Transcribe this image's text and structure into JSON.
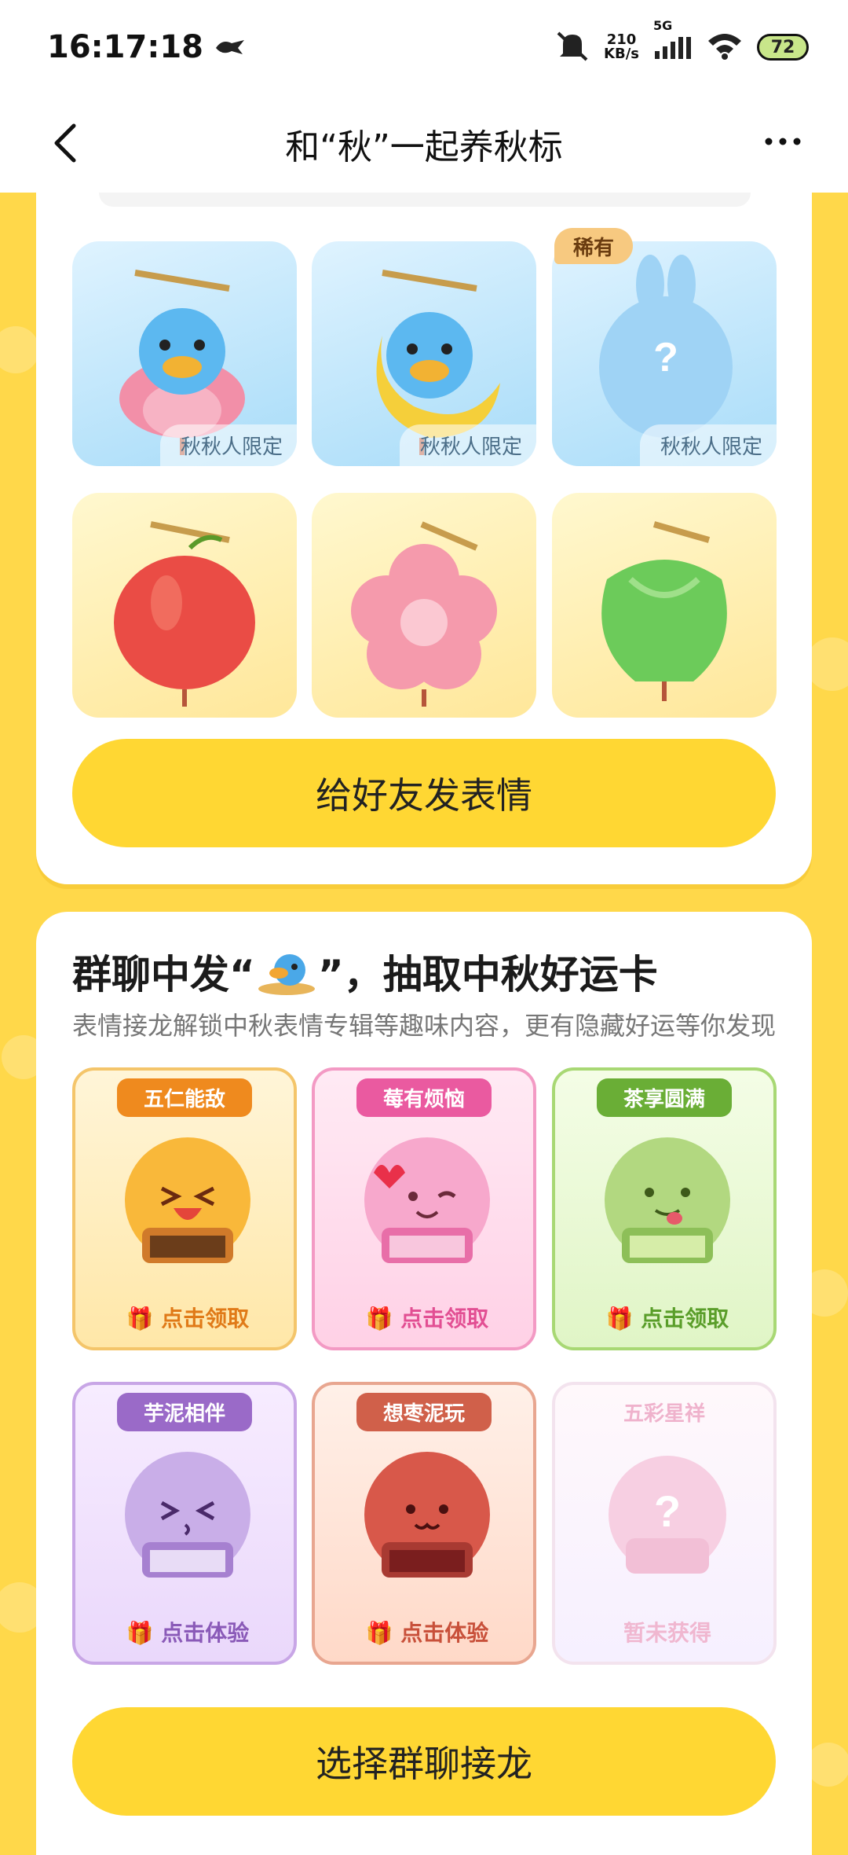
{
  "status_bar": {
    "time": "16:17:18",
    "net_speed_value": "210",
    "net_speed_unit": "KB/s",
    "network": "5G",
    "battery": "72"
  },
  "header": {
    "title": "和“秋”一起养秋标"
  },
  "lanterns": [
    {
      "tag": "秋秋人限定",
      "style": "blue",
      "icon": "lotus-bird-lantern"
    },
    {
      "tag": "秋秋人限定",
      "style": "blue",
      "icon": "moon-bird-lantern"
    },
    {
      "tag": "秋秋人限定",
      "style": "blue",
      "icon": "mystery-rabbit-lantern",
      "rare": "稀有"
    },
    {
      "style": "yellow",
      "icon": "apple-lantern"
    },
    {
      "style": "yellow",
      "icon": "flower-lantern"
    },
    {
      "style": "yellow",
      "icon": "cabbage-lantern"
    }
  ],
  "send_button": "给好友发表情",
  "section2": {
    "title_prefix": "群聊中发“",
    "title_suffix": "”，抽取中秋好运卡",
    "subtitle": "表情接龙解锁中秋表情专辑等趣味内容，更有隐藏好运等你发现"
  },
  "mooncakes": [
    {
      "label": "五仁能敌",
      "action": "点击领取",
      "color": "#ef8a1e"
    },
    {
      "label": "莓有烦恼",
      "action": "点击领取",
      "color": "#ea5aa0"
    },
    {
      "label": "茶享圆满",
      "action": "点击领取",
      "color": "#6aae36"
    },
    {
      "label": "芋泥相伴",
      "action": "点击体验",
      "color": "#9a6ac8"
    },
    {
      "label": "想枣泥玩",
      "action": "点击体验",
      "color": "#d0604a"
    },
    {
      "label": "五彩星祥",
      "action": "暂未获得",
      "color": "#f0b7d0"
    }
  ],
  "chain_button": "选择群聊接龙"
}
